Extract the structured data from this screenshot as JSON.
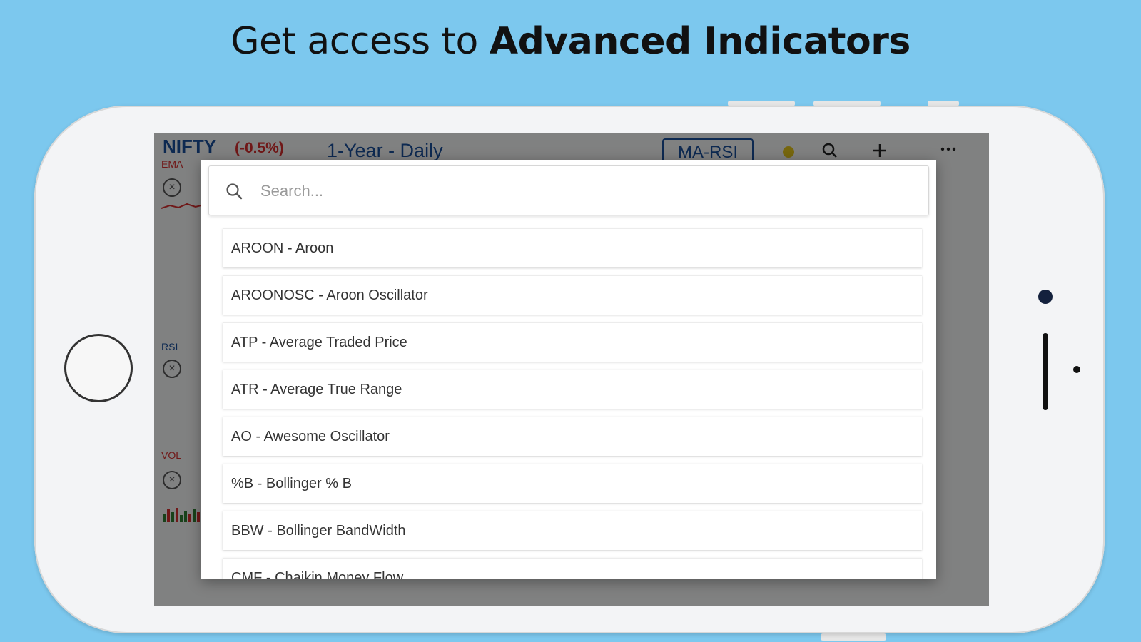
{
  "headline": {
    "prefix": "Get access to",
    "emphasis": "Advanced Indicators"
  },
  "chart_screen": {
    "symbol": "NIFTY",
    "change": "(-0.5%)",
    "period": "1-Year - Daily",
    "template": "MA-RSI",
    "ema_label": "EMA",
    "rsi_label": "RSI",
    "vol_label": "VOL",
    "icons": [
      "search-icon",
      "plus-icon",
      "more-icon",
      "close-circle-icon"
    ]
  },
  "indicator_picker": {
    "search_placeholder": "Search...",
    "items": [
      "AROON - Aroon",
      "AROONOSC - Aroon Oscillator",
      "ATP - Average Traded Price",
      "ATR - Average True Range",
      "AO - Awesome Oscillator",
      "%B - Bollinger % B",
      "BBW - Bollinger BandWidth",
      "CMF - Chaikin Money Flow"
    ]
  },
  "colors": {
    "background": "#7cc8ee",
    "brand_blue": "#1a4f9a",
    "negative_red": "#d32f2f"
  }
}
